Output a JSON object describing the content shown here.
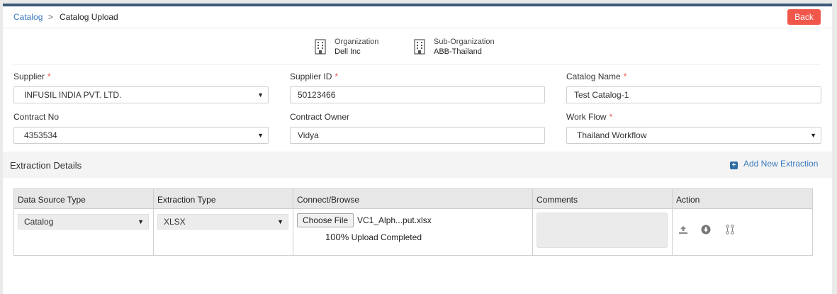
{
  "breadcrumb": {
    "parent": "Catalog",
    "separator": ">",
    "current": "Catalog Upload"
  },
  "header": {
    "back_label": "Back"
  },
  "org": {
    "organization_label": "Organization",
    "organization_value": "Dell Inc",
    "suborg_label": "Sub-Organization",
    "suborg_value": "ABB-Thailand"
  },
  "form": {
    "required_marker": "*",
    "supplier_label": "Supplier",
    "supplier_value": "INFUSIL INDIA PVT. LTD.",
    "supplier_id_label": "Supplier ID",
    "supplier_id_value": "50123466",
    "catalog_name_label": "Catalog Name",
    "catalog_name_value": "Test Catalog-1",
    "contract_no_label": "Contract No",
    "contract_no_value": "4353534",
    "contract_owner_label": "Contract Owner",
    "contract_owner_value": "Vidya",
    "workflow_label": "Work Flow",
    "workflow_value": "Thailand Workflow",
    "dropdown_arrow": "▼"
  },
  "extraction": {
    "title": "Extraction Details",
    "add_icon": "+",
    "add_label": "Add New Extraction",
    "columns": [
      "Data Source Type",
      "Extraction Type",
      "Connect/Browse",
      "Comments",
      "Action"
    ],
    "row": {
      "data_source": "Catalog",
      "extraction_type": "XLSX",
      "choose_file_label": "Choose File",
      "file_name": "VC1_Alph...put.xlsx",
      "upload_percent": "100%",
      "upload_status": "Upload Completed"
    }
  },
  "icons": {
    "organization": "building-icon",
    "suborganization": "building-icon",
    "upload": "upload-icon",
    "download": "download-circle-icon",
    "mapping": "mapping-icon"
  },
  "colors": {
    "back_button": "#f0574a",
    "link": "#3a7bbf",
    "top_border": "#3b5a78",
    "required": "#e05a4f"
  }
}
